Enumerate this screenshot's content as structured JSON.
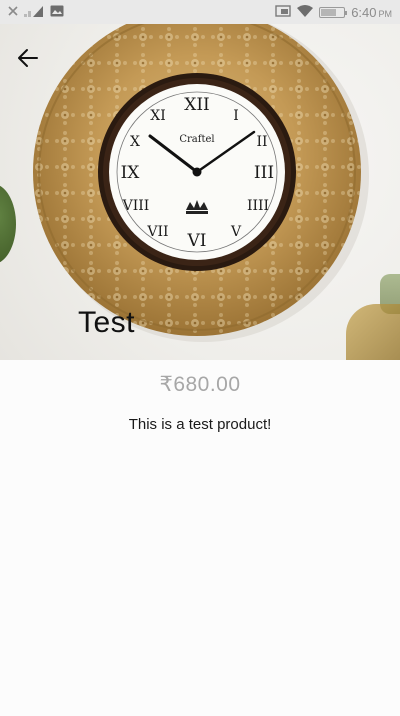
{
  "status_bar": {
    "time": "6:40",
    "time_suffix": "PM",
    "icons": [
      "close-icon",
      "signal-icon",
      "image-icon",
      "cast-icon",
      "wifi-icon",
      "battery-icon"
    ]
  },
  "header": {
    "back_icon": "arrow-left-icon"
  },
  "hero": {
    "clock_brand": "Craftel"
  },
  "product": {
    "title": "Test",
    "price": "₹680.00",
    "description": "This is a test product!"
  },
  "colors": {
    "price": "#a7a7a7",
    "title": "#111111",
    "status_bar_bg": "#e9e9e9"
  }
}
